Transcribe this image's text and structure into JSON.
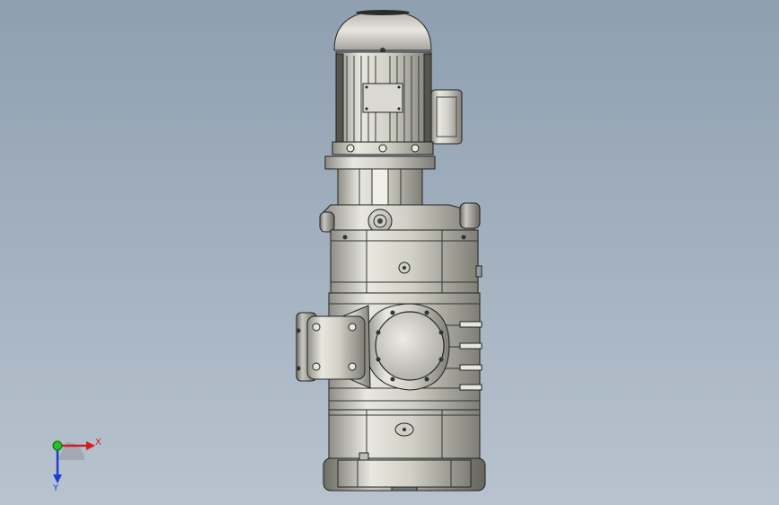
{
  "viewport": {
    "background_top": "#8f9fb0",
    "background_bottom": "#b8c3cf"
  },
  "model": {
    "metal_light": "#e4e4dc",
    "metal_mid": "#c5c5bc",
    "metal_dark": "#8a8a82",
    "edge": "#2a2a2a"
  },
  "triad": {
    "x_label": "X",
    "y_label": "Y",
    "x_color": "#d41e1e",
    "y_color": "#1e3cd4",
    "z_color": "#22c222"
  }
}
